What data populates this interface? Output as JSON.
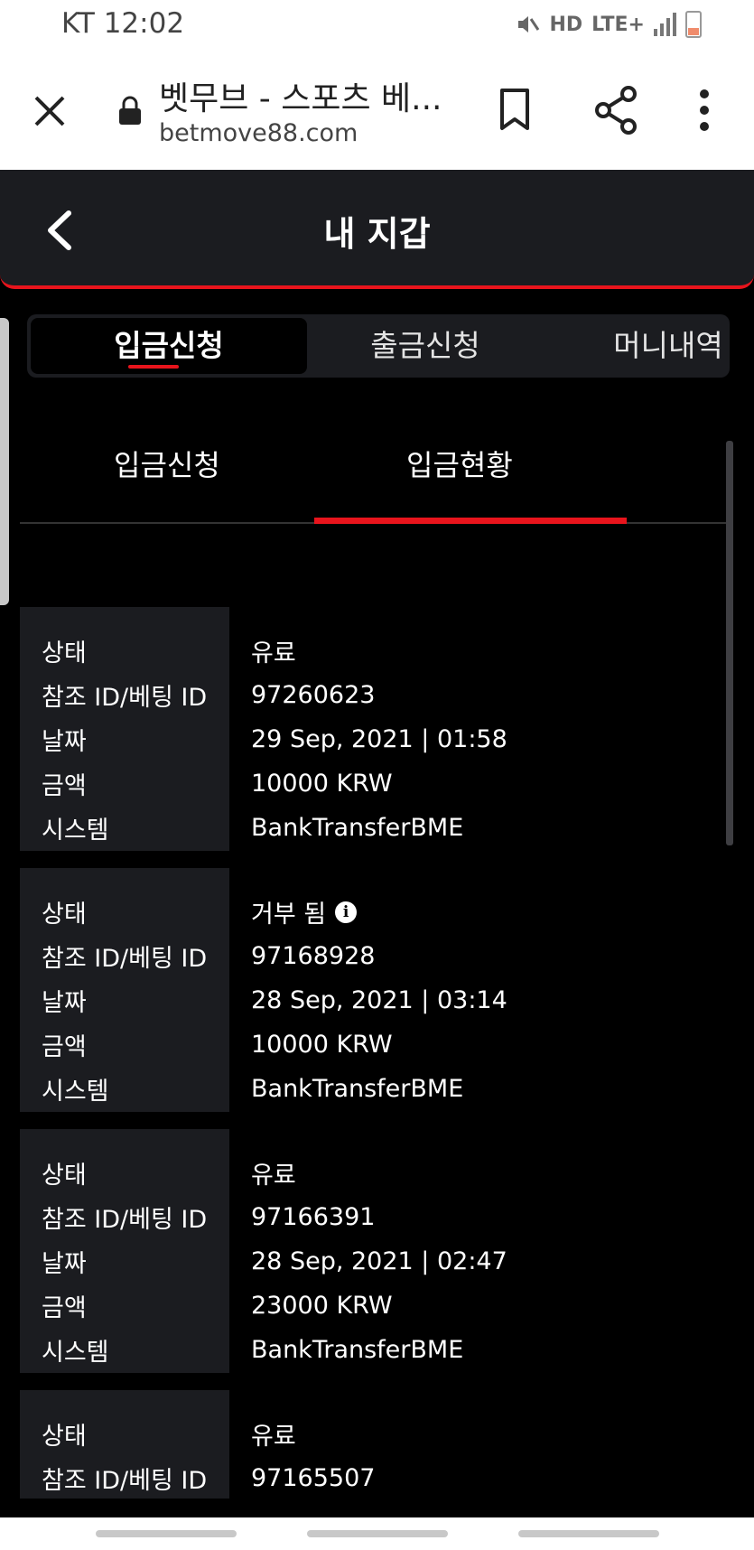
{
  "status_bar": {
    "carrier_time": "KT 12:02",
    "hd": "HD",
    "lte": "LTE+"
  },
  "browser": {
    "title": "벳무브 - 스포츠 베...",
    "domain": "betmove88.com"
  },
  "header": {
    "title": "내 지갑"
  },
  "main_tabs": [
    {
      "label": "입금신청",
      "active": true
    },
    {
      "label": "출금신청",
      "active": false
    },
    {
      "label": "머니내역",
      "active": false
    }
  ],
  "sub_tabs": [
    {
      "label": "입금신청",
      "active": false
    },
    {
      "label": "입금현황",
      "active": true
    }
  ],
  "labels": {
    "status": "상태",
    "ref_id": "참조 ID/베팅 ID",
    "date": "날짜",
    "amount": "금액",
    "system": "시스템"
  },
  "records": [
    {
      "status": "유료",
      "ref_id": "97260623",
      "date": "29 Sep, 2021 | 01:58",
      "amount": "10000 KRW",
      "system": "BankTransferBME"
    },
    {
      "status": "거부 됨",
      "ref_id": "97168928",
      "date": "28 Sep, 2021 | 03:14",
      "amount": "10000 KRW",
      "system": "BankTransferBME",
      "info_icon": "i"
    },
    {
      "status": "유료",
      "ref_id": "97166391",
      "date": "28 Sep, 2021 | 02:47",
      "amount": "23000 KRW",
      "system": "BankTransferBME"
    },
    {
      "status": "유료",
      "ref_id": "97165507"
    }
  ],
  "colors": {
    "accent": "#e8141c",
    "panel": "#1b1c20",
    "background": "#000000"
  }
}
